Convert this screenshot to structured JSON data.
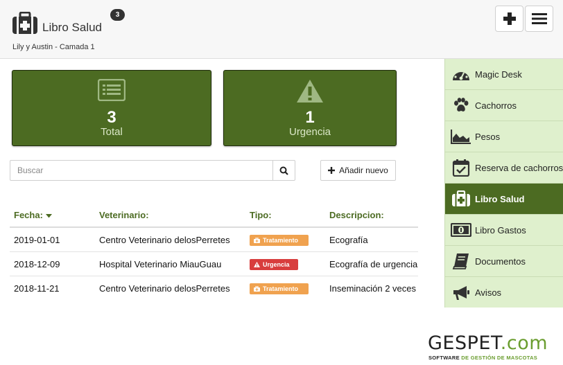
{
  "header": {
    "title": "Libro Salud",
    "badge": "3",
    "subtitle": "Lily y Austin - Camada 1"
  },
  "stats": {
    "total": {
      "value": "3",
      "label": "Total",
      "icon": "list-icon"
    },
    "urgencia": {
      "value": "1",
      "label": "Urgencia",
      "icon": "warning-icon"
    }
  },
  "search": {
    "placeholder": "Buscar",
    "value": ""
  },
  "add_button": {
    "label": "Añadir nuevo"
  },
  "table": {
    "headers": {
      "fecha": "Fecha:",
      "veterinario": "Veterinario:",
      "tipo": "Tipo:",
      "descripcion": "Descripcion:"
    },
    "rows": [
      {
        "fecha": "2019-01-01",
        "veterinario": "Centro Veterinario delosPerretes",
        "tipo": "Tratamiento",
        "descripcion": "Ecografía"
      },
      {
        "fecha": "2018-12-09",
        "veterinario": "Hospital Veterinario MiauGuau",
        "tipo": "Urgencia",
        "descripcion": "Ecografía de urgencia"
      },
      {
        "fecha": "2018-11-21",
        "veterinario": "Centro Veterinario delosPerretes",
        "tipo": "Tratamiento",
        "descripcion": "Inseminación 2 veces"
      }
    ]
  },
  "sidebar": {
    "items": [
      {
        "label": "Magic Desk",
        "icon": "dashboard-icon"
      },
      {
        "label": "Cachorros",
        "icon": "paw-icon"
      },
      {
        "label": "Pesos",
        "icon": "area-chart-icon"
      },
      {
        "label": "Reserva de cachorros",
        "icon": "calendar-check-icon"
      },
      {
        "label": "Libro Salud",
        "icon": "medkit-icon",
        "active": true
      },
      {
        "label": "Libro Gastos",
        "icon": "money-icon"
      },
      {
        "label": "Documentos",
        "icon": "book-icon"
      },
      {
        "label": "Avisos",
        "icon": "bullhorn-icon"
      }
    ]
  },
  "logo": {
    "brand_a": "GESPET",
    "brand_b": ".com",
    "tagline_a": "SOFTWARE ",
    "tagline_b": "DE GESTIÓN DE MASCOTAS"
  },
  "colors": {
    "accent_green": "#4c6b22",
    "sidebar_bg": "#dff0cd",
    "tratamiento_tag": "#f0a24f",
    "urgencia_tag": "#d83d3d"
  }
}
